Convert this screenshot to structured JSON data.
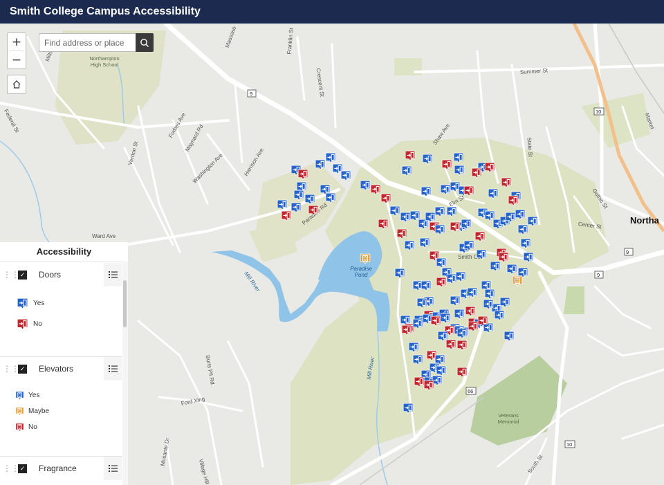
{
  "app": {
    "title": "Smith College Campus Accessibility"
  },
  "search": {
    "placeholder": "Find address or place"
  },
  "controls": {
    "zoom_in": "+",
    "zoom_out": "−",
    "home_icon": "home-icon",
    "search_icon": "search-icon"
  },
  "legend": {
    "title": "Accessibility",
    "layers": [
      {
        "name": "Doors",
        "checked": true,
        "items": [
          {
            "label": "Yes",
            "color": "#2563c9"
          },
          {
            "label": "No",
            "color": "#c0272d"
          }
        ]
      },
      {
        "name": "Elevators",
        "checked": true,
        "items": [
          {
            "label": "Yes",
            "color": "#2563c9"
          },
          {
            "label": "Maybe",
            "color": "#e0a34a"
          },
          {
            "label": "No",
            "color": "#c0272d"
          }
        ]
      },
      {
        "name": "Fragrance",
        "checked": true,
        "items": []
      }
    ]
  },
  "map": {
    "streets": [
      "Federal St",
      "Milton",
      "Massaso",
      "Franklin St",
      "Crescent St",
      "Summer St",
      "Forbes Ave",
      "Maynard Rd",
      "Vernon St",
      "Washington Ave",
      "Harrison Ave",
      "Paradise Rd",
      "Ward Ave",
      "Shaw Ave",
      "State St",
      "Gothic St",
      "Center St",
      "Market",
      "Mill River",
      "Ford Xing",
      "Village Hill Rd",
      "Musante Dr",
      "Burts Pit Rd",
      "South St",
      "Elm St",
      "Smith Co"
    ],
    "places": {
      "school": [
        "Northampton",
        "High School"
      ],
      "pond": [
        "Paradise",
        "Pond"
      ],
      "memorial": [
        "Veterans",
        "Memorial"
      ],
      "town": "Northa"
    },
    "route_shields": [
      "9",
      "9",
      "9",
      "10",
      "10",
      "66"
    ],
    "colors": {
      "door_yes": "#2563c9",
      "door_no": "#c0272d",
      "maybe": "#e0a34a",
      "water": "#8fc3e8",
      "park": "#dcdfc0",
      "header": "#1b2a4e"
    }
  }
}
